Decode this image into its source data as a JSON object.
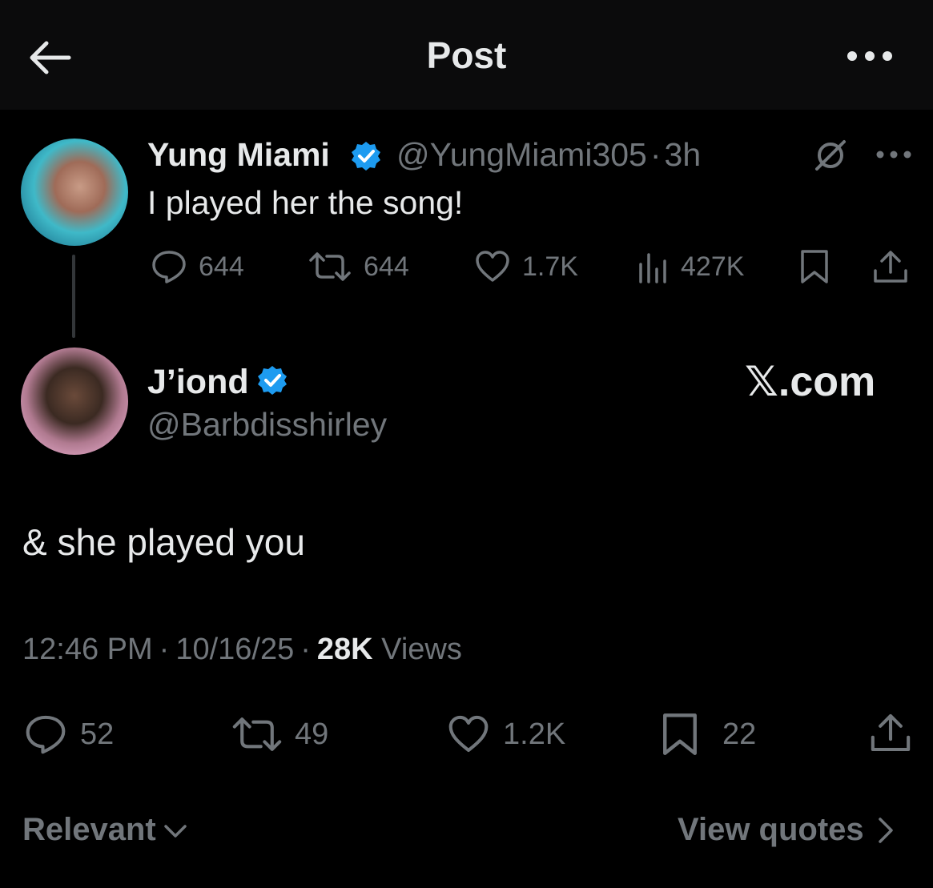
{
  "header": {
    "title": "Post",
    "back_icon": "arrow-left-icon",
    "more_icon": "more-horizontal-icon"
  },
  "quoted_post": {
    "author_name": "Yung Miami",
    "handle": "@YungMiami305",
    "separator": "·",
    "time": "3h",
    "text": "I played her the song!",
    "replies": "644",
    "reposts": "644",
    "likes": "1.7K",
    "views": "427K"
  },
  "main_post": {
    "author_name": "J’iond",
    "handle": "@Barbdisshirley",
    "watermark": "𝕏.com",
    "text": "& she played you",
    "time": "12:46 PM",
    "separator1": "·",
    "date": "10/16/25",
    "separator2": "·",
    "views_count": "28K",
    "views_label": "Views",
    "replies": "52",
    "reposts": "49",
    "likes": "1.2K",
    "bookmarks": "22"
  },
  "footer": {
    "sort_label": "Relevant",
    "view_quotes_label": "View quotes"
  },
  "colors": {
    "background": "#000000",
    "header_background": "#0b0b0c",
    "primary_text": "#e7e9ea",
    "secondary_text": "#71767b",
    "verified_blue": "#1d9bf0"
  }
}
